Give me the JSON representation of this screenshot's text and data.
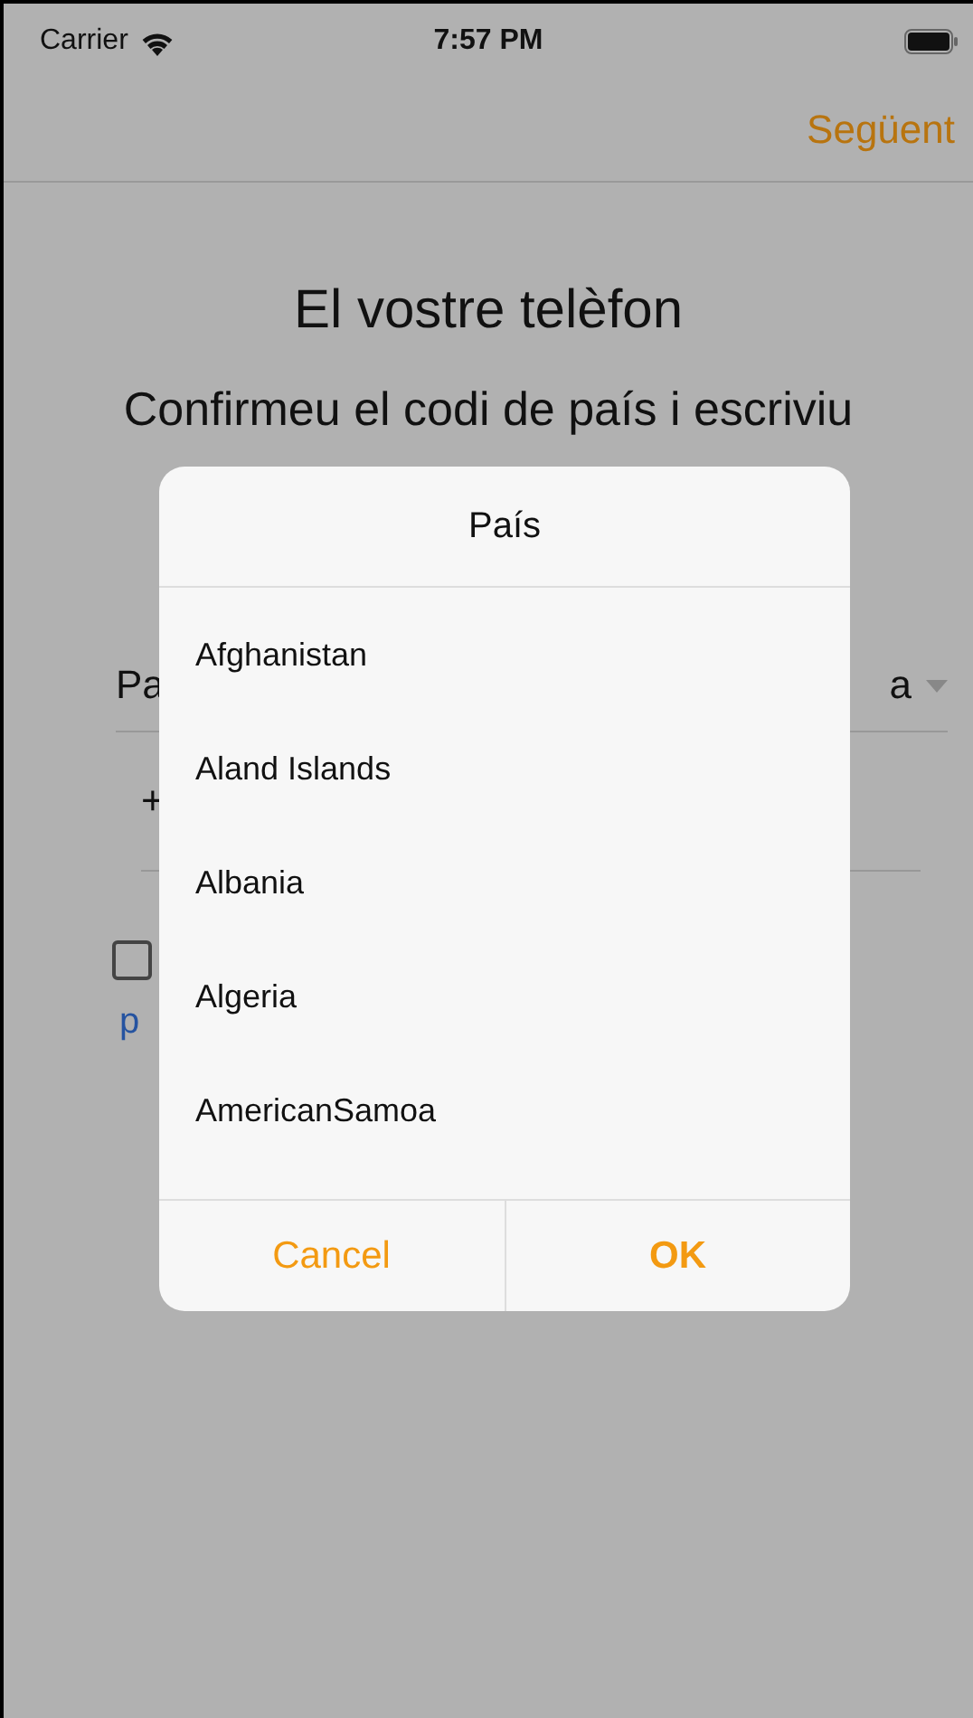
{
  "status_bar": {
    "carrier": "Carrier",
    "time": "7:57 PM"
  },
  "nav_bar": {
    "next_button": "Següent"
  },
  "page": {
    "title": "El vostre telèfon",
    "subtitle": "Confirmeu el codi de país i escriviu",
    "country_field": {
      "label": "Pa",
      "value": "a"
    },
    "phone_field": {
      "prefix": "+"
    },
    "agree_checkbox": {
      "checked": false
    },
    "link": "p"
  },
  "dialog": {
    "title": "País",
    "items": [
      {
        "label": "Afghanistan"
      },
      {
        "label": "Aland Islands"
      },
      {
        "label": "Albania"
      },
      {
        "label": "Algeria"
      },
      {
        "label": "AmericanSamoa"
      }
    ],
    "buttons": [
      {
        "label": "Cancel",
        "kind": "cancel"
      },
      {
        "label": "OK",
        "kind": "confirm"
      }
    ]
  }
}
